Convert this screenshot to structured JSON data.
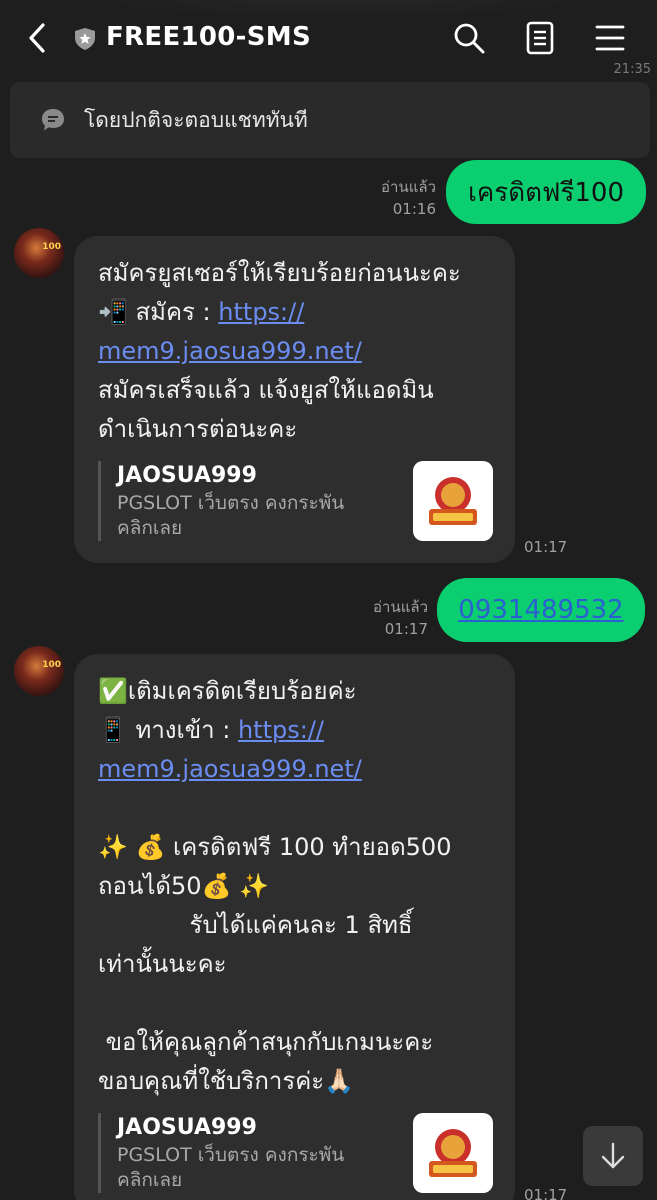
{
  "header": {
    "title": "FREE100-SMS",
    "faded_time": "21:35"
  },
  "notice": {
    "text": "โดยปกติจะตอบแชททันที"
  },
  "messages": {
    "sent1": {
      "text": "เครดิตฟรี100",
      "read_label": "อ่านแล้ว",
      "time": "01:16"
    },
    "recv1": {
      "lines": [
        "สมัครยูสเซอร์ให้เรียบร้อยก่อนนะคะ",
        "📲 สมัคร : ",
        "สมัครเสร็จแล้ว แจ้งยูสให้แอดมิน",
        "ดำเนินการต่อนะคะ"
      ],
      "link_a": "https://",
      "link_b": "mem9.jaosua999.net/",
      "preview_title": "JAOSUA999",
      "preview_desc1": "PGSLOT เว็บตรง คงกระพัน",
      "preview_desc2": "คลิกเลย",
      "time": "01:17"
    },
    "sent2": {
      "text": "0931489532",
      "read_label": "อ่านแล้ว",
      "time": "01:17"
    },
    "recv2": {
      "line1": "✅เติมเครดิตเรียบร้อยค่ะ",
      "line2_prefix": "📱 ทางเข้า : ",
      "link_a": "https://",
      "link_b": "mem9.jaosua999.net/",
      "line4": "✨ 💰 เครดิตฟรี 100 ทำยอด500",
      "line5": "ถอนได้50💰 ✨",
      "line6": "            รับได้แค่คนละ 1 สิทธิ์",
      "line7": "เท่านั้นนะคะ",
      "line9": " ขอให้คุณลูกค้าสนุกกับเกมนะคะ",
      "line10": "ขอบคุณที่ใช้บริการค่ะ🙏🏻",
      "preview_title": "JAOSUA999",
      "preview_desc1": "PGSLOT เว็บตรง คงกระพัน",
      "preview_desc2": "คลิกเลย",
      "time": "01:17"
    }
  },
  "avatar": {
    "badge": "100"
  },
  "colors": {
    "sent_bubble": "#0ace6f",
    "recv_bubble": "#2e2e2e",
    "link": "#6b8cf0",
    "background": "#1e1e1e"
  },
  "icons": [
    "back-icon",
    "shield-icon",
    "search-icon",
    "notes-icon",
    "menu-icon",
    "chat-bubble-icon",
    "scroll-down-icon"
  ]
}
